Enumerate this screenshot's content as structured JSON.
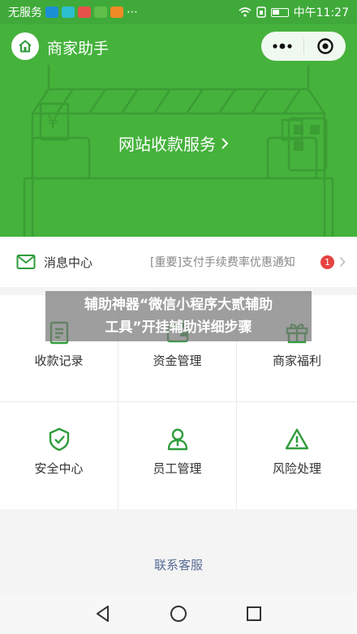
{
  "status_bar": {
    "carrier": "无服务",
    "time": "中午11:27"
  },
  "header": {
    "title": "商家助手"
  },
  "hero": {
    "link_label": "网站收款服务"
  },
  "notice": {
    "title": "消息中心",
    "text": "[重要]支付手续费率优惠通知",
    "badge": "1"
  },
  "grid": {
    "items": [
      {
        "label": "收款记录",
        "icon": "receipt-icon"
      },
      {
        "label": "资金管理",
        "icon": "wallet-icon"
      },
      {
        "label": "商家福利",
        "icon": "gift-icon"
      },
      {
        "label": "安全中心",
        "icon": "shield-icon"
      },
      {
        "label": "员工管理",
        "icon": "person-icon"
      },
      {
        "label": "风险处理",
        "icon": "warning-icon"
      }
    ]
  },
  "overlay": {
    "line1": "辅助神器“微信小程序大贰辅助",
    "line2": "工具”开挂辅助详细步骤"
  },
  "footer": {
    "contact_label": "联系客服"
  },
  "colors": {
    "brand_green": "#45b23c",
    "icon_green": "#2f9c3c",
    "badge_red": "#e64340",
    "link_blue": "#576b95"
  }
}
